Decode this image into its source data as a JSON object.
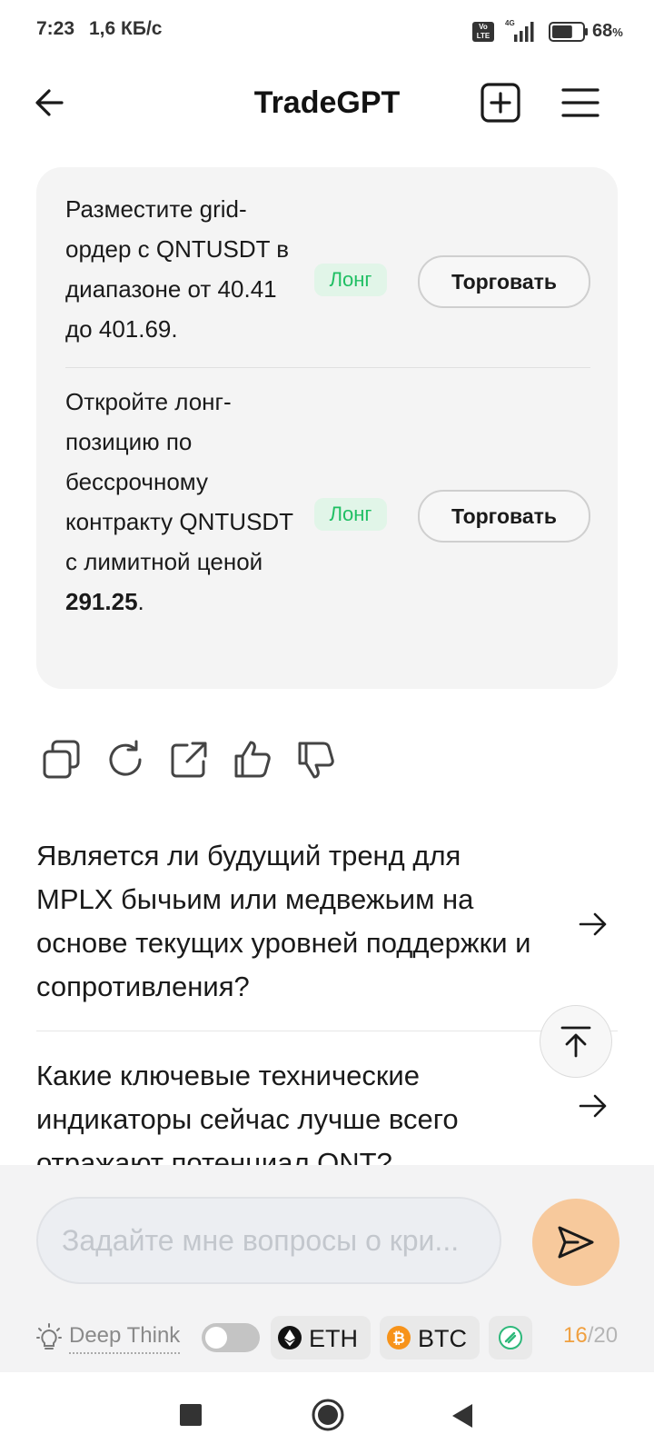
{
  "status_bar": {
    "time": "7:23",
    "speed": "1,6 КБ/с",
    "volte_label": "Vo LTE",
    "network": "4G",
    "battery_percent": "68",
    "battery_unit": "%",
    "battery_level": 0.68
  },
  "header": {
    "title": "TradeGPT",
    "back_icon": "arrow-left-icon",
    "new_chat_icon": "plus-square-icon",
    "menu_icon": "hamburger-icon"
  },
  "card": {
    "rows": [
      {
        "text": "Разместите grid-ордер с QNTUSDT в диапазоне от 40.41 до 401.69.",
        "tag": "Лонг",
        "button": "Торговать"
      },
      {
        "text_prefix": "Откройте лонг-позицию по бессрочному контракту QNTUSDT с лимитной ценой ",
        "text_bold": "291.25",
        "text_suffix": ".",
        "tag": "Лонг",
        "button": "Торговать"
      }
    ]
  },
  "actions": [
    "copy-icon",
    "regenerate-icon",
    "share-icon",
    "thumbs-up-icon",
    "thumbs-down-icon"
  ],
  "suggestions": [
    {
      "text": "Является ли будущий тренд для MPLX бычьим или медвежьим на основе текущих уровней поддержки и сопротивления?"
    },
    {
      "text": "Какие ключевые технические индикаторы сейчас лучше всего отражают потенциал QNT?"
    }
  ],
  "composer": {
    "placeholder": "Задайте мне вопросы о кри...",
    "deep_think_label": "Deep Think",
    "deep_think_on": false,
    "chips": [
      {
        "label": "ETH",
        "icon": "ethereum-icon",
        "color": "#111111"
      },
      {
        "label": "BTC",
        "icon": "bitcoin-icon",
        "color": "#f7931a"
      }
    ],
    "counter_used": "16",
    "counter_total": "/20"
  },
  "colors": {
    "accent_green": "#1fbf63",
    "send_button": "#f7c99c",
    "counter_orange": "#f0a040"
  }
}
